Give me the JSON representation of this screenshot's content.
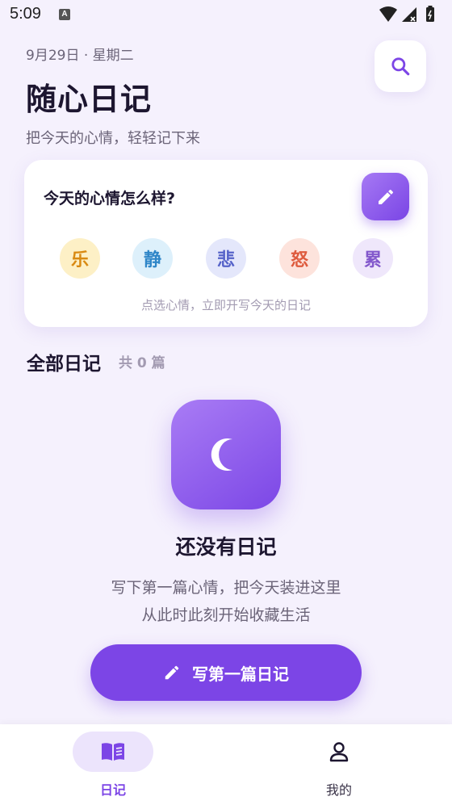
{
  "status_bar": {
    "time": "5:09",
    "notification_badge": "A"
  },
  "header": {
    "date": "9月29日 · 星期二",
    "title": "随心日记",
    "subtitle": "把今天的心情，轻轻记下来",
    "search_icon": "search-icon"
  },
  "mood_card": {
    "question": "今天的心情怎么样?",
    "edit_icon": "pencil-icon",
    "moods": [
      {
        "label": "乐",
        "bg": "#fdf0c6",
        "color": "#d98a12"
      },
      {
        "label": "静",
        "bg": "#ddf0fb",
        "color": "#2f86c8"
      },
      {
        "label": "悲",
        "bg": "#e4e7fb",
        "color": "#5663c9"
      },
      {
        "label": "怒",
        "bg": "#fde3dc",
        "color": "#de5b3e"
      },
      {
        "label": "累",
        "bg": "#efe7fb",
        "color": "#8358cc"
      }
    ],
    "hint": "点选心情，立即开写今天的日记"
  },
  "section": {
    "title": "全部日记",
    "count": "共 0 篇"
  },
  "empty_state": {
    "icon": "moon-icon",
    "title": "还没有日记",
    "line1": "写下第一篇心情，把今天装进这里",
    "line2": "从此时此刻开始收藏生活",
    "button_label": "写第一篇日记",
    "button_icon": "pencil-icon"
  },
  "bottom_nav": {
    "items": [
      {
        "label": "日记",
        "icon": "book-icon",
        "active": true
      },
      {
        "label": "我的",
        "icon": "person-icon",
        "active": false
      }
    ]
  },
  "colors": {
    "accent": "#7c45e6",
    "background": "#f5f1fd",
    "text_primary": "#1d1630",
    "text_secondary": "#6b6478",
    "text_muted": "#a39bb2"
  }
}
